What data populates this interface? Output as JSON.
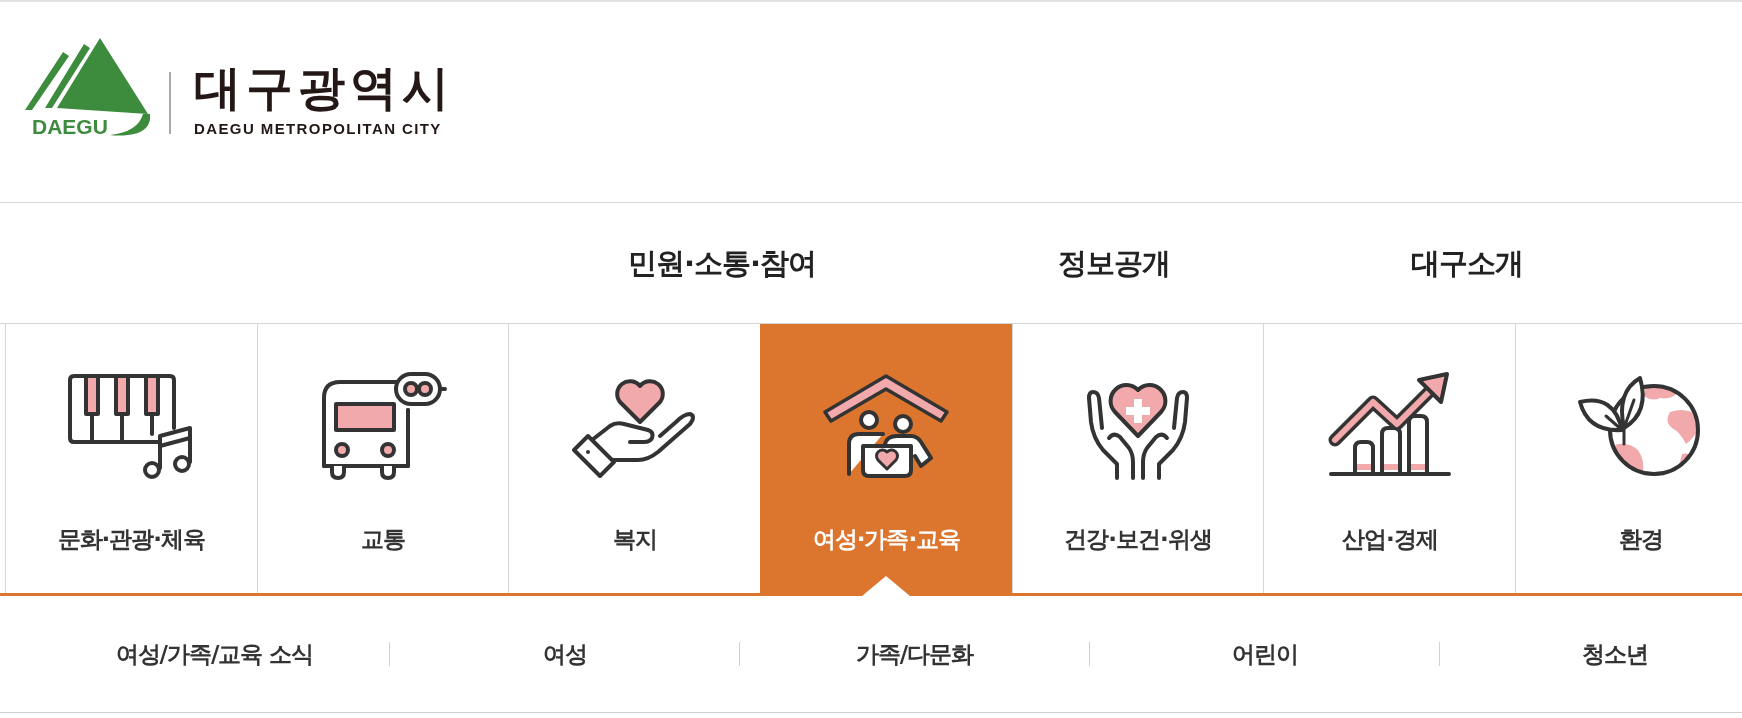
{
  "header": {
    "logo": {
      "emblem_text": "DAEGU",
      "name": "대구광역시",
      "subtitle": "DAEGU METROPOLITAN CITY"
    }
  },
  "main_menu": [
    "민원·소통·참여",
    "정보공개",
    "대구소개"
  ],
  "categories": [
    {
      "label": "문화·관광·체육",
      "selected": false
    },
    {
      "label": "교통",
      "selected": false
    },
    {
      "label": "복지",
      "selected": false
    },
    {
      "label": "여성·가족·교육",
      "selected": true
    },
    {
      "label": "건강·보건·위생",
      "selected": false
    },
    {
      "label": "산업·경제",
      "selected": false
    },
    {
      "label": "환경",
      "selected": false
    }
  ],
  "submenu": [
    "여성/가족/교육 소식",
    "여성",
    "가족/다문화",
    "어린이",
    "청소년"
  ]
}
